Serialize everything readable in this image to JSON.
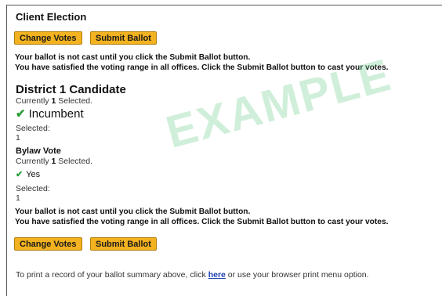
{
  "page": {
    "title": "Client Election",
    "watermark": "EXAMPLE"
  },
  "buttons": {
    "change_votes": "Change Votes",
    "submit_ballot": "Submit Ballot"
  },
  "notice": {
    "line1": "Your ballot is not cast until you click the Submit Ballot button.",
    "line2": "You have satisfied the voting range in all offices. Click the Submit Ballot button to cast your votes."
  },
  "offices": [
    {
      "title": "District 1 Candidate",
      "currently_prefix": "Currently ",
      "selected_count": "1",
      "currently_suffix": " Selected.",
      "choice": "Incumbent",
      "selected_label": "Selected:",
      "selected_value": "1"
    },
    {
      "title": "Bylaw Vote",
      "currently_prefix": "Currently ",
      "selected_count": "1",
      "currently_suffix": " Selected.",
      "choice": "Yes",
      "selected_label": "Selected:",
      "selected_value": "1"
    }
  ],
  "print": {
    "prefix": "To print a record of your ballot summary above, click ",
    "link": "here",
    "suffix": " or use your browser print menu option."
  },
  "colors": {
    "button_bg": "#f3b21f",
    "check": "#2a9d3a",
    "link": "#1a3fb3",
    "watermark": "#78d296"
  },
  "icons": {
    "check": "check-icon"
  }
}
